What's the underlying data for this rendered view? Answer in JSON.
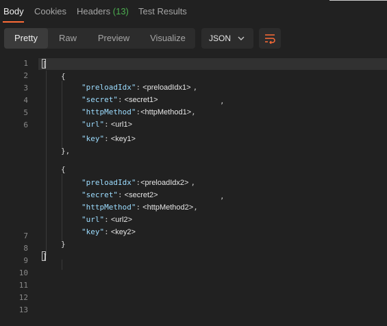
{
  "tabs": [
    {
      "label": "Body"
    },
    {
      "label": "Cookies"
    },
    {
      "label": "Headers",
      "count": "(13)"
    },
    {
      "label": "Test Results"
    }
  ],
  "toolbar": {
    "views": [
      "Pretty",
      "Raw",
      "Preview",
      "Visualize"
    ],
    "format": "JSON",
    "format_icon": "chevron-down-icon",
    "wrap_icon": "wrap-lines-icon"
  },
  "editor": {
    "line_numbers": [
      "1",
      "2",
      "3",
      "4",
      "5",
      "6",
      "7",
      "8",
      "9",
      "10",
      "11",
      "12",
      "13"
    ],
    "open_bracket": "[",
    "close_bracket": "]",
    "open_brace": "{",
    "close_brace_comma": "},",
    "close_brace": "}",
    "colon": ":",
    "comma": ",",
    "objects": [
      {
        "keys": [
          "\"preloadIdx\"",
          "\"secret\"",
          "\"httpMethod\"",
          "\"url\"",
          "\"key\""
        ],
        "values": [
          "<preloadIdx1>",
          "<secret1>",
          "<httpMethod1>",
          "<url1>",
          "<key1>"
        ]
      },
      {
        "keys": [
          "\"preloadIdx\"",
          "\"secret\"",
          "\"httpMethod\"",
          "\"url\"",
          "\"key\""
        ],
        "values": [
          "<preloadIdx2>",
          "<secret2>",
          "<httpMethod2>",
          "<url2>",
          "<key2>"
        ]
      }
    ]
  },
  "colors": {
    "background": "#212121",
    "accent": "#ff6c37",
    "count": "#4caf50",
    "json_key": "#9cdcfe"
  }
}
